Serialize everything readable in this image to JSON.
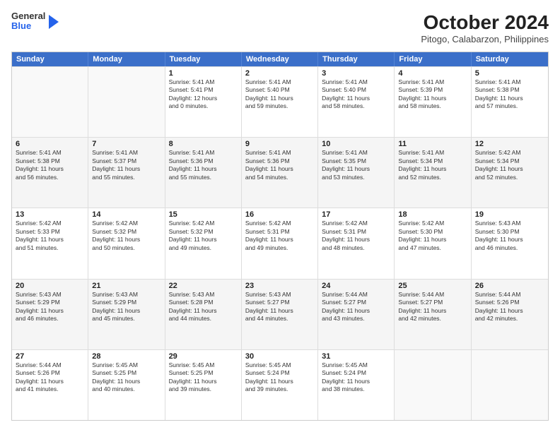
{
  "logo": {
    "general": "General",
    "blue": "Blue",
    "arrow": "▶"
  },
  "header": {
    "title": "October 2024",
    "subtitle": "Pitogo, Calabarzon, Philippines"
  },
  "dayHeaders": [
    "Sunday",
    "Monday",
    "Tuesday",
    "Wednesday",
    "Thursday",
    "Friday",
    "Saturday"
  ],
  "weeks": [
    [
      {
        "day": "",
        "info": ""
      },
      {
        "day": "",
        "info": ""
      },
      {
        "day": "1",
        "info": "Sunrise: 5:41 AM\nSunset: 5:41 PM\nDaylight: 12 hours\nand 0 minutes."
      },
      {
        "day": "2",
        "info": "Sunrise: 5:41 AM\nSunset: 5:40 PM\nDaylight: 11 hours\nand 59 minutes."
      },
      {
        "day": "3",
        "info": "Sunrise: 5:41 AM\nSunset: 5:40 PM\nDaylight: 11 hours\nand 58 minutes."
      },
      {
        "day": "4",
        "info": "Sunrise: 5:41 AM\nSunset: 5:39 PM\nDaylight: 11 hours\nand 58 minutes."
      },
      {
        "day": "5",
        "info": "Sunrise: 5:41 AM\nSunset: 5:38 PM\nDaylight: 11 hours\nand 57 minutes."
      }
    ],
    [
      {
        "day": "6",
        "info": "Sunrise: 5:41 AM\nSunset: 5:38 PM\nDaylight: 11 hours\nand 56 minutes."
      },
      {
        "day": "7",
        "info": "Sunrise: 5:41 AM\nSunset: 5:37 PM\nDaylight: 11 hours\nand 55 minutes."
      },
      {
        "day": "8",
        "info": "Sunrise: 5:41 AM\nSunset: 5:36 PM\nDaylight: 11 hours\nand 55 minutes."
      },
      {
        "day": "9",
        "info": "Sunrise: 5:41 AM\nSunset: 5:36 PM\nDaylight: 11 hours\nand 54 minutes."
      },
      {
        "day": "10",
        "info": "Sunrise: 5:41 AM\nSunset: 5:35 PM\nDaylight: 11 hours\nand 53 minutes."
      },
      {
        "day": "11",
        "info": "Sunrise: 5:41 AM\nSunset: 5:34 PM\nDaylight: 11 hours\nand 52 minutes."
      },
      {
        "day": "12",
        "info": "Sunrise: 5:42 AM\nSunset: 5:34 PM\nDaylight: 11 hours\nand 52 minutes."
      }
    ],
    [
      {
        "day": "13",
        "info": "Sunrise: 5:42 AM\nSunset: 5:33 PM\nDaylight: 11 hours\nand 51 minutes."
      },
      {
        "day": "14",
        "info": "Sunrise: 5:42 AM\nSunset: 5:32 PM\nDaylight: 11 hours\nand 50 minutes."
      },
      {
        "day": "15",
        "info": "Sunrise: 5:42 AM\nSunset: 5:32 PM\nDaylight: 11 hours\nand 49 minutes."
      },
      {
        "day": "16",
        "info": "Sunrise: 5:42 AM\nSunset: 5:31 PM\nDaylight: 11 hours\nand 49 minutes."
      },
      {
        "day": "17",
        "info": "Sunrise: 5:42 AM\nSunset: 5:31 PM\nDaylight: 11 hours\nand 48 minutes."
      },
      {
        "day": "18",
        "info": "Sunrise: 5:42 AM\nSunset: 5:30 PM\nDaylight: 11 hours\nand 47 minutes."
      },
      {
        "day": "19",
        "info": "Sunrise: 5:43 AM\nSunset: 5:30 PM\nDaylight: 11 hours\nand 46 minutes."
      }
    ],
    [
      {
        "day": "20",
        "info": "Sunrise: 5:43 AM\nSunset: 5:29 PM\nDaylight: 11 hours\nand 46 minutes."
      },
      {
        "day": "21",
        "info": "Sunrise: 5:43 AM\nSunset: 5:29 PM\nDaylight: 11 hours\nand 45 minutes."
      },
      {
        "day": "22",
        "info": "Sunrise: 5:43 AM\nSunset: 5:28 PM\nDaylight: 11 hours\nand 44 minutes."
      },
      {
        "day": "23",
        "info": "Sunrise: 5:43 AM\nSunset: 5:27 PM\nDaylight: 11 hours\nand 44 minutes."
      },
      {
        "day": "24",
        "info": "Sunrise: 5:44 AM\nSunset: 5:27 PM\nDaylight: 11 hours\nand 43 minutes."
      },
      {
        "day": "25",
        "info": "Sunrise: 5:44 AM\nSunset: 5:27 PM\nDaylight: 11 hours\nand 42 minutes."
      },
      {
        "day": "26",
        "info": "Sunrise: 5:44 AM\nSunset: 5:26 PM\nDaylight: 11 hours\nand 42 minutes."
      }
    ],
    [
      {
        "day": "27",
        "info": "Sunrise: 5:44 AM\nSunset: 5:26 PM\nDaylight: 11 hours\nand 41 minutes."
      },
      {
        "day": "28",
        "info": "Sunrise: 5:45 AM\nSunset: 5:25 PM\nDaylight: 11 hours\nand 40 minutes."
      },
      {
        "day": "29",
        "info": "Sunrise: 5:45 AM\nSunset: 5:25 PM\nDaylight: 11 hours\nand 39 minutes."
      },
      {
        "day": "30",
        "info": "Sunrise: 5:45 AM\nSunset: 5:24 PM\nDaylight: 11 hours\nand 39 minutes."
      },
      {
        "day": "31",
        "info": "Sunrise: 5:45 AM\nSunset: 5:24 PM\nDaylight: 11 hours\nand 38 minutes."
      },
      {
        "day": "",
        "info": ""
      },
      {
        "day": "",
        "info": ""
      }
    ]
  ]
}
